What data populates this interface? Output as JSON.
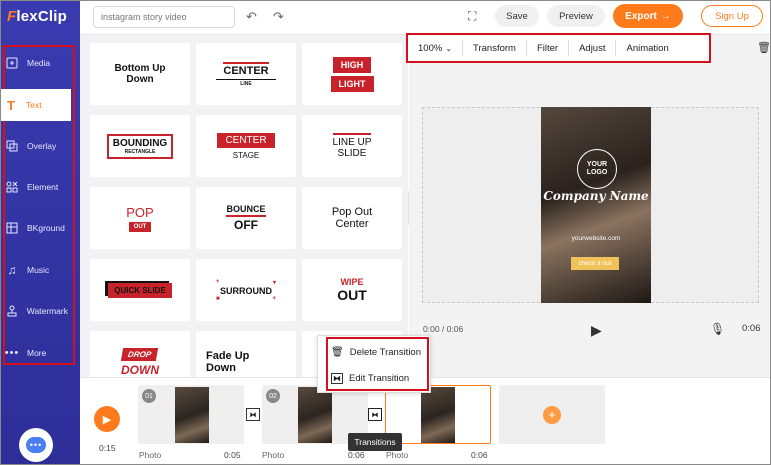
{
  "app": {
    "logo_f": "F",
    "logo_rest": "lexClip"
  },
  "topbar": {
    "search_value": "instagram story video",
    "save_label": "Save",
    "preview_label": "Preview",
    "export_label": "Export",
    "signup_label": "Sign Up"
  },
  "sidebar": {
    "items": [
      {
        "label": "Media",
        "icon": "media-icon"
      },
      {
        "label": "Text",
        "icon": "text-icon"
      },
      {
        "label": "Overlay",
        "icon": "overlay-icon"
      },
      {
        "label": "Element",
        "icon": "element-icon"
      },
      {
        "label": "BKground",
        "icon": "background-icon"
      },
      {
        "label": "Music",
        "icon": "music-icon"
      },
      {
        "label": "Watermark",
        "icon": "watermark-icon"
      },
      {
        "label": "More",
        "icon": "more-icon"
      }
    ],
    "active": "Text"
  },
  "text_panel": {
    "cards": [
      {
        "l1": "Bottom Up",
        "l2": "Down"
      },
      {
        "l1": "CENTER",
        "l2": "LINE"
      },
      {
        "l1": "HIGH",
        "l2": "LIGHT"
      },
      {
        "l1": "BOUNDING",
        "l2": "RECTANGLE"
      },
      {
        "l1": "CENTER",
        "l2": "STAGE"
      },
      {
        "l1": "LINE UP",
        "l2": "SLIDE"
      },
      {
        "l1": "POP",
        "l2": "OUT"
      },
      {
        "l1": "BOUNCE",
        "l2": "OFF"
      },
      {
        "l1": "Pop Out",
        "l2": "Center"
      },
      {
        "l1": "QUICK SLIDE",
        "l2": ""
      },
      {
        "l1": "SURROUND",
        "l2": ""
      },
      {
        "l1": "WIPE",
        "l2": "OUT"
      },
      {
        "l1": "DROP",
        "l2": "DOWN"
      },
      {
        "l1": "Fade Up",
        "l2": "Down"
      }
    ]
  },
  "toolbar": {
    "zoom": "100%",
    "items": [
      "Transform",
      "Filter",
      "Adjust",
      "Animation"
    ]
  },
  "canvas": {
    "logo_text_1": "YOUR",
    "logo_text_2": "LOGO",
    "company": "Company Name",
    "website": "yourwebsite.com",
    "cta": "check it out"
  },
  "player": {
    "current": "0:00 / 0:06",
    "total": "0:06"
  },
  "context_menu": {
    "delete_label": "Delete Transition",
    "edit_label": "Edit Transition"
  },
  "tooltip": "Transitions",
  "timeline": {
    "duration": "0:15",
    "clips": [
      {
        "num": "01",
        "label": "Photo",
        "dur": "0:05"
      },
      {
        "num": "02",
        "label": "Photo",
        "dur": "0:06"
      },
      {
        "num": "",
        "label": "Photo",
        "dur": "0:06"
      }
    ]
  },
  "colors": {
    "accent": "#ff7a1a",
    "sidebar": "#3a3bb0",
    "highlight": "#d60f1f"
  }
}
